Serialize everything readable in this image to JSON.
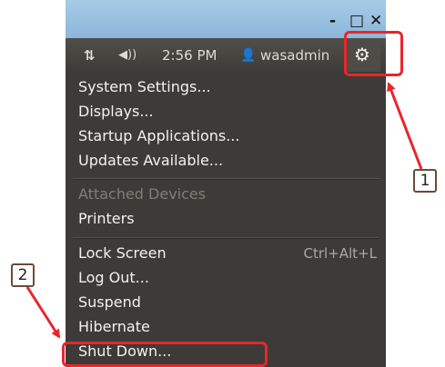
{
  "window": {
    "minimize": "-",
    "maximize": "□",
    "close": "✕"
  },
  "panel": {
    "network_icon": "⇅",
    "volume_icon": "◀))",
    "time": "2:56 PM",
    "user_icon": "👤",
    "username": "wasadmin",
    "gear_icon": "⚙"
  },
  "menu": {
    "items": [
      {
        "label": "System Settings..."
      },
      {
        "label": "Displays..."
      },
      {
        "label": "Startup Applications..."
      },
      {
        "label": "Updates Available..."
      },
      {
        "label": "Attached Devices"
      },
      {
        "label": "Printers"
      },
      {
        "label": "Lock Screen",
        "shortcut": "Ctrl+Alt+L"
      },
      {
        "label": "Log Out..."
      },
      {
        "label": "Suspend"
      },
      {
        "label": "Hibernate"
      },
      {
        "label": "Shut Down..."
      }
    ]
  },
  "annotations": {
    "step1": "1",
    "step2": "2"
  },
  "colors": {
    "highlight": "#e8262c",
    "menu_bg": "#3c3b37",
    "panel_bg": "#3c3b37"
  }
}
